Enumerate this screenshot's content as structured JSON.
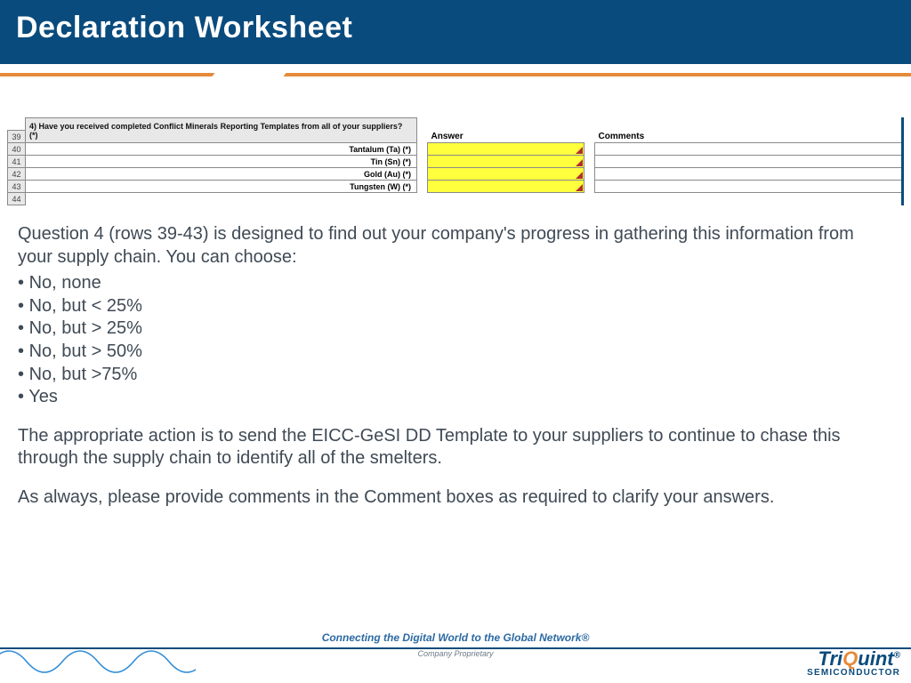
{
  "header": {
    "title": "Declaration Worksheet"
  },
  "sheet": {
    "question": "4) Have you received completed Conflict Minerals Reporting Templates from all of your suppliers? (*)",
    "col_answer": "Answer",
    "col_comments": "Comments",
    "row39": "39",
    "row40": "40",
    "row41": "41",
    "row42": "42",
    "row43": "43",
    "row44": "44",
    "metal_ta": "Tantalum (Ta) (*)",
    "metal_sn": "Tin (Sn) (*)",
    "metal_au": "Gold (Au) (*)",
    "metal_w": "Tungsten (W) (*)"
  },
  "body": {
    "intro": "Question 4 (rows 39-43) is designed to find out your company's progress in gathering this information from your supply chain.  You can choose:",
    "opt1": "No, none",
    "opt2": "No, but < 25%",
    "opt3": "No, but > 25%",
    "opt4": "No, but > 50%",
    "opt5": "No, but >75%",
    "opt6": "Yes",
    "para2": "The appropriate action is to send the EICC-GeSI DD Template to your suppliers to continue to chase this through the supply chain to identify all of the smelters.",
    "para3": "As always, please provide comments in the Comment boxes as required to clarify your answers."
  },
  "footer": {
    "tagline": "Connecting the Digital World to the Global Network®",
    "subtag": "Company Proprietary",
    "brand_pre": "Tri",
    "brand_q": "Q",
    "brand_post": "uint",
    "brand_sub": "SEMICONDUCTOR"
  }
}
